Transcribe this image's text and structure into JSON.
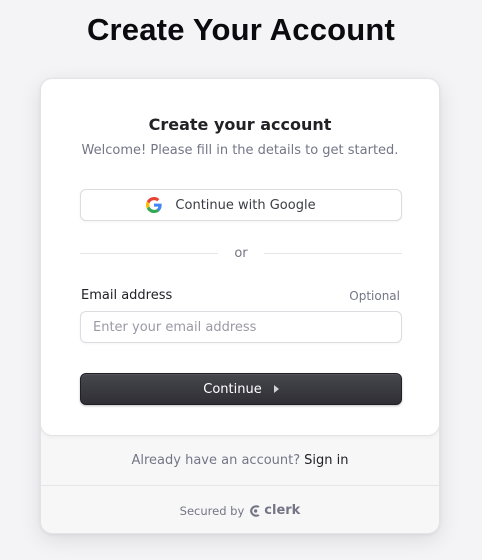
{
  "page": {
    "title": "Create Your Account"
  },
  "card": {
    "title": "Create your account",
    "subtitle": "Welcome! Please fill in the details to get started."
  },
  "social": {
    "google_label": "Continue with Google",
    "google_icon": "google-icon"
  },
  "divider": {
    "text": "or"
  },
  "email": {
    "label": "Email address",
    "optional": "Optional",
    "placeholder": "Enter your email address",
    "value": ""
  },
  "continue": {
    "label": "Continue",
    "icon": "caret-right-icon"
  },
  "footer": {
    "prompt": "Already have an account?",
    "signin_label": "Sign in",
    "secured_by": "Secured by",
    "brand": "clerk"
  },
  "colors": {
    "background": "#f4f4f7",
    "primary_button": "#2f2f35",
    "text_primary": "#212126",
    "text_muted": "#747686"
  }
}
